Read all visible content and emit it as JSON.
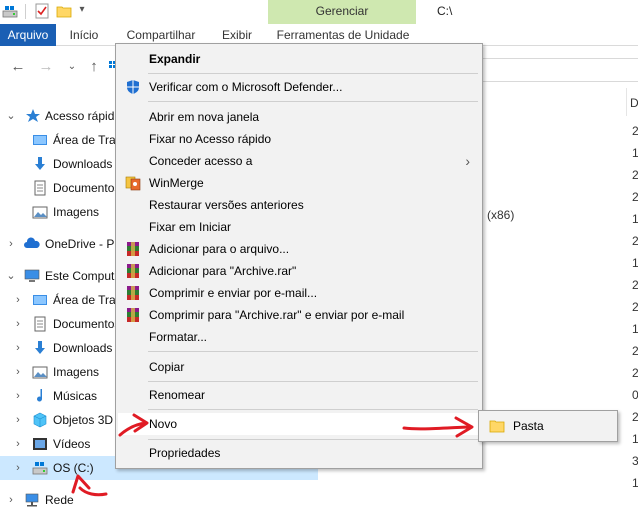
{
  "titlebar": {
    "path": "C:\\"
  },
  "ribbon": {
    "context_group": "Gerenciar",
    "tabs": [
      "Arquivo",
      "Início",
      "Compartilhar",
      "Exibir",
      "Ferramentas de Unidade"
    ]
  },
  "nav_pane": {
    "items": [
      {
        "label": "Acesso rápid",
        "icon": "star-icon"
      },
      {
        "label": "Área de Trab",
        "icon": "desktop-folder-icon"
      },
      {
        "label": "Downloads",
        "icon": "downloads-icon"
      },
      {
        "label": "Documentos",
        "icon": "documents-icon"
      },
      {
        "label": "Imagens",
        "icon": "pictures-icon"
      },
      {
        "label": "OneDrive - P",
        "icon": "cloud-icon"
      },
      {
        "label": "Este Comput",
        "icon": "computer-icon"
      },
      {
        "label": "Área de Trab",
        "icon": "desktop-folder-icon"
      },
      {
        "label": "Documentos",
        "icon": "documents-icon"
      },
      {
        "label": "Downloads",
        "icon": "downloads-icon"
      },
      {
        "label": "Imagens",
        "icon": "pictures-icon"
      },
      {
        "label": "Músicas",
        "icon": "music-icon"
      },
      {
        "label": "Objetos 3D",
        "icon": "cube-icon"
      },
      {
        "label": "Vídeos",
        "icon": "video-icon"
      },
      {
        "label": "OS (C:)",
        "icon": "drive-icon"
      },
      {
        "label": "Rede",
        "icon": "network-icon"
      }
    ]
  },
  "content": {
    "header_fragment": "D",
    "row_fragment": "(x86)",
    "date_column_fragments": [
      "2",
      "1",
      "2",
      "2",
      "1",
      "2",
      "1",
      "2",
      "2",
      "1",
      "2",
      "2",
      "0",
      "2",
      "1",
      "3",
      "1"
    ]
  },
  "context_menu": {
    "items": [
      {
        "label": "Expandir",
        "bold": true
      },
      {
        "label": "Verificar com o Microsoft Defender...",
        "icon": "defender-shield-icon"
      },
      {
        "label": "Abrir em nova janela"
      },
      {
        "label": "Fixar no Acesso rápido"
      },
      {
        "label": "Conceder acesso a",
        "submenu": true
      },
      {
        "label": "WinMerge",
        "icon": "winmerge-icon"
      },
      {
        "label": "Restaurar versões anteriores"
      },
      {
        "label": "Fixar em Iniciar"
      },
      {
        "label": "Adicionar para o arquivo...",
        "icon": "winrar-icon"
      },
      {
        "label": "Adicionar para \"Archive.rar\"",
        "icon": "winrar-icon"
      },
      {
        "label": "Comprimir e enviar por e-mail...",
        "icon": "winrar-icon"
      },
      {
        "label": "Comprimir para \"Archive.rar\" e enviar por e-mail",
        "icon": "winrar-icon"
      },
      {
        "label": "Formatar..."
      },
      {
        "label": "Copiar"
      },
      {
        "label": "Renomear"
      },
      {
        "label": "Novo",
        "submenu": true,
        "highlighted": true
      },
      {
        "label": "Propriedades"
      }
    ]
  },
  "submenu_novo": {
    "items": [
      {
        "label": "Pasta",
        "icon": "folder-icon"
      }
    ]
  },
  "colors": {
    "accent": "#1a5fb4",
    "selection": "#cce8ff",
    "manage_tab": "#cfe8b0",
    "annotation": "#e01b24"
  }
}
